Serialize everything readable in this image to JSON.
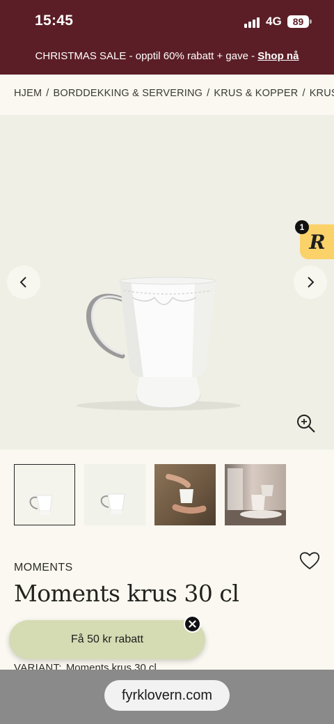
{
  "status_bar": {
    "time": "15:45",
    "network": "4G",
    "battery": "89"
  },
  "promo": {
    "text": "CHRISTMAS SALE - opptil 60% rabatt + gave - ",
    "link": "Shop nå"
  },
  "breadcrumb": [
    "HJEM",
    "BORDDEKKING & SERVERING",
    "KRUS & KOPPER",
    "KRUS"
  ],
  "breadcrumb_separator": "/",
  "gallery": {
    "badge_count": "1",
    "badge_letter": "R"
  },
  "product": {
    "brand": "MOMENTS",
    "title": "Moments krus 30 cl",
    "variant_label": "VARIANT:",
    "variant_value": "Moments krus 30 cl"
  },
  "discount": {
    "label": "Få 50 kr rabatt"
  },
  "browser": {
    "url": "fyrklovern.com"
  },
  "colors": {
    "header": "#5b1e26",
    "page": "#faf8f0",
    "gallery_bg": "#efefe5",
    "discount_pill": "#d5dbb3",
    "badge": "#fbd26a"
  },
  "icons": [
    "chevron-left-icon",
    "chevron-right-icon",
    "zoom-in-icon",
    "heart-icon",
    "close-icon"
  ]
}
